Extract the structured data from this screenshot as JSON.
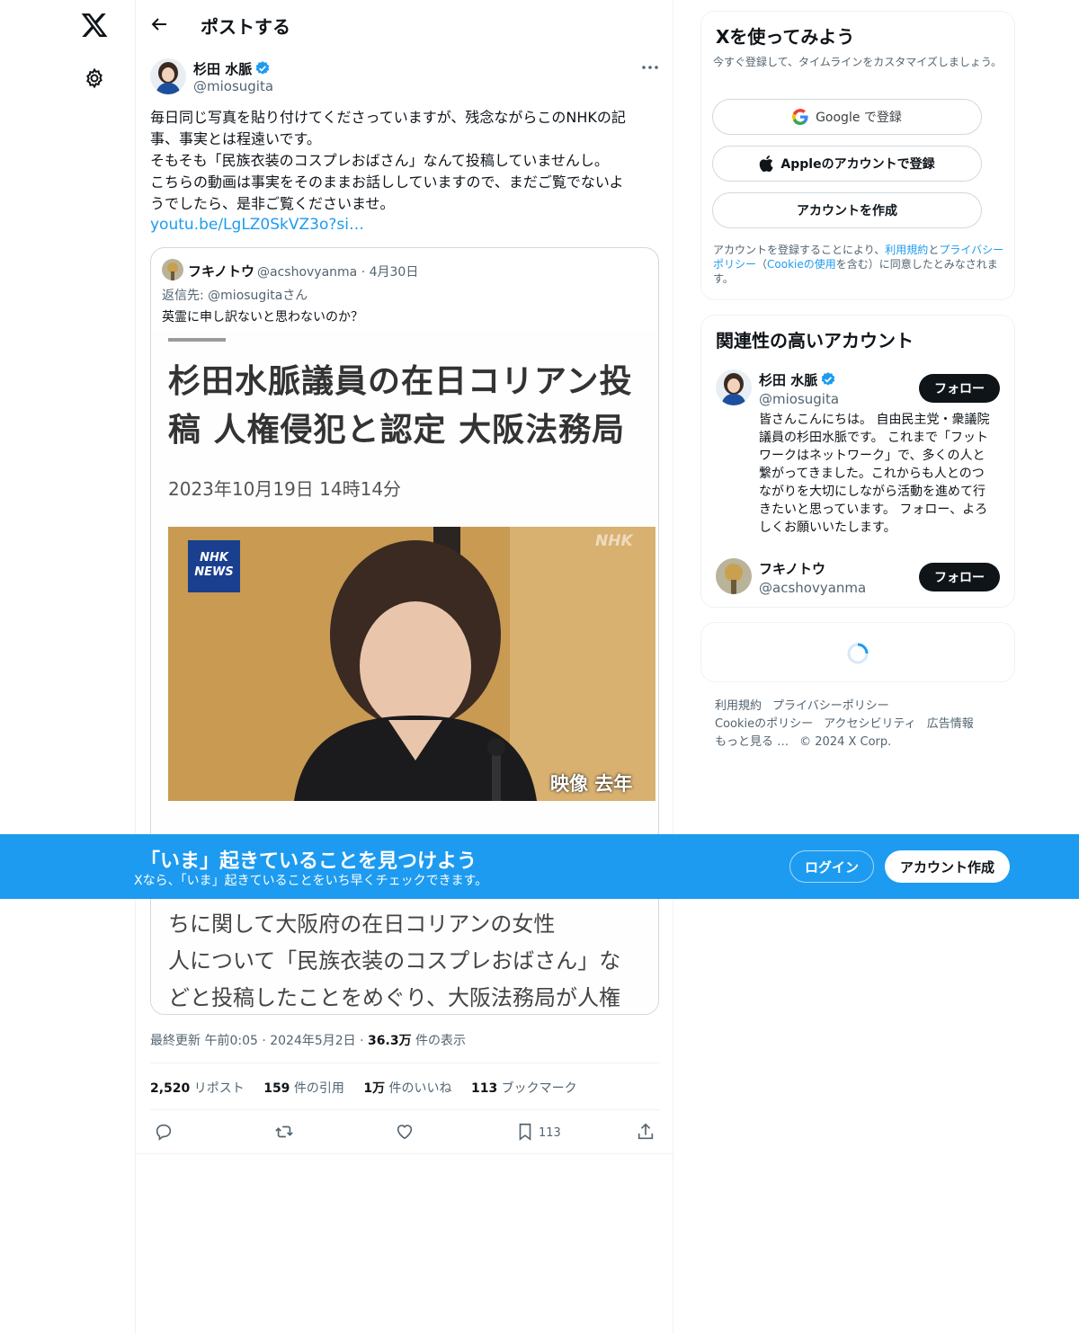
{
  "topbar": {
    "title": "ポストする"
  },
  "post": {
    "author_name": "杉田 水脈",
    "author_handle": "@miosugita",
    "body": "毎日同じ写真を貼り付けてくださっていますが、残念ながらこのNHKの記\n事、事実とは程遠いです。\nそもそも「民族衣装のコスプレおばさん」なんて投稿していませんし。\nこちらの動画は事実をそのままお話ししていますので、まだご覧でないよ\nうでしたら、是非ご覧くださいませ。",
    "link": "youtu.be/LgLZ0SkVZ3o?si…",
    "meta_prefix": "最終更新 午前0:05 · 2024年5月2日 · ",
    "views_value": "36.3万",
    "views_label": " 件の表示"
  },
  "quote": {
    "name": "フキノトウ",
    "handle_date": "@acshovyanma · 4月30日",
    "reply_to": "返信先: @miosugitaさん",
    "text": "英霊に申し訳ないと思わないのか？",
    "headline": "杉田水脈議員の在日コリアン投稿 人権侵犯と認定 大阪法務局",
    "date": "2023年10月19日 14時14分",
    "nhk_badge_1": "NHK",
    "nhk_badge_2": "NEWS",
    "nhk_watermark": "NHK",
    "photo_caption": "映像 去年",
    "article_body": "ちに関して大阪府の在日コリアンの女性\n人について「民族衣装のコスプレおばさん」な\nどと投稿したことをめぐり、大阪法務局が人権\n侵犯と認定したことが分かりました。"
  },
  "stats": {
    "reposts_value": "2,520",
    "reposts_label": " リポスト",
    "quotes_value": "159",
    "quotes_label": " 件の引用",
    "likes_value": "1万",
    "likes_label": " 件のいいね",
    "bookmarks_value": "113",
    "bookmarks_label": " ブックマーク"
  },
  "actions": {
    "bookmark_count": "113"
  },
  "signup": {
    "title": "Xを使ってみよう",
    "subtitle": "今すぐ登録して、タイムラインをカスタマイズしましょう。",
    "google": "Google で登録",
    "apple": "Appleのアカウントで登録",
    "create": "アカウントを作成",
    "legal_1": "アカウントを登録することにより、",
    "legal_terms": "利用規約",
    "legal_2": "と",
    "legal_privacy": "プライバシーポリシー",
    "legal_3": "（",
    "legal_cookie": "Cookieの使用",
    "legal_4": "を含む）に同意したとみなされます。"
  },
  "related": {
    "title": "関連性の高いアカウント",
    "accounts": [
      {
        "name": "杉田 水脈",
        "handle": "@miosugita",
        "follow": "フォロー",
        "bio": "皆さんこんにちは。 自由民主党・衆議院議員の杉田水脈です。 これまで「フットワークはネットワーク」で、多くの人と繋がってきました。これからも人とのつながりを大切にしながら活動を進めて行きたいと思っています。 フォロー、よろしくお願いいたします。"
      },
      {
        "name": "フキノトウ",
        "handle": "@acshovyanma",
        "follow": "フォロー"
      }
    ]
  },
  "footer": {
    "terms": "利用規約",
    "privacy": "プライバシーポリシー",
    "cookie": "Cookieのポリシー",
    "accessibility": "アクセシビリティ",
    "ads": "広告情報",
    "more": "もっと見る …",
    "copyright": "© 2024 X Corp."
  },
  "banner": {
    "title": "「いま」起きていることを見つけよう",
    "subtitle": "Xなら、「いま」起きていることをいち早くチェックできます。",
    "login": "ログイン",
    "signup": "アカウント作成"
  },
  "colors": {
    "accent": "#1d9bf0",
    "text": "#0f1419",
    "muted": "#536471",
    "border": "#eff3f4"
  }
}
